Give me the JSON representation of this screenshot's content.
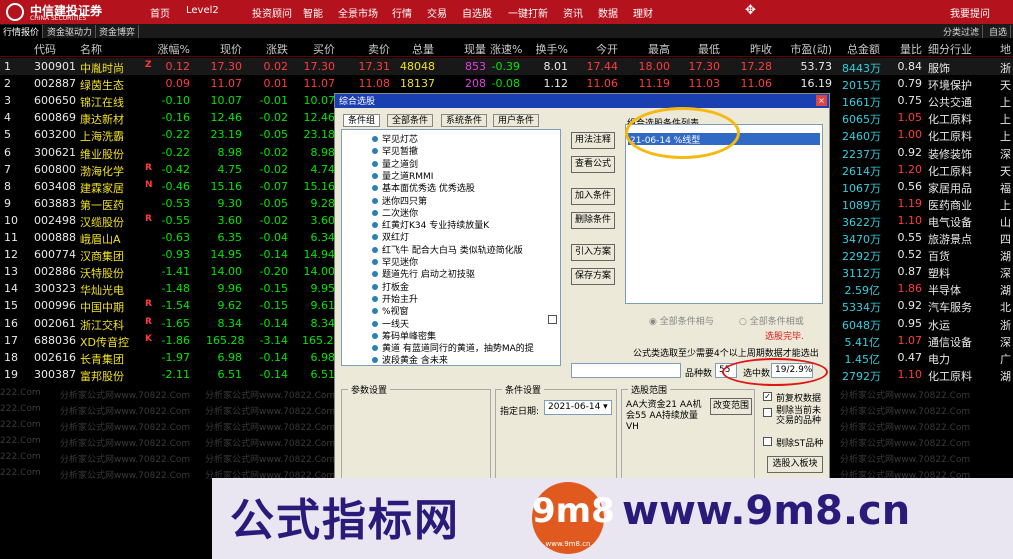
{
  "app": {
    "logo_cn": "中信建投证券",
    "logo_en": "CHINA SECURITIES",
    "nav": [
      "首页",
      "Level2",
      "投资顾问",
      "智能",
      "全景市场",
      "行情",
      "交易",
      "自选股",
      "一键打新",
      "资讯",
      "数据",
      "理财"
    ],
    "hot_badge": "HOT",
    "help": "我要提问"
  },
  "tabs": [
    "行情报价",
    "资金驱动力",
    "资金博弈"
  ],
  "tabs_right": [
    "分类过滤",
    "自选"
  ],
  "table": {
    "columns": [
      "",
      "代码",
      "名称",
      "涨幅%",
      "现价",
      "涨跌",
      "买价",
      "卖价",
      "总量",
      "现量",
      "涨速%",
      "换手%",
      "今开",
      "最高",
      "最低",
      "昨收",
      "市盈(动)",
      "总金额",
      "量比",
      "细分行业",
      "地"
    ],
    "rows": [
      [
        "1",
        "300901",
        "中胤时尚",
        "Z",
        "0.12",
        "17.30",
        "0.02",
        "17.30",
        "17.31",
        "48048",
        "853",
        "-0.39",
        "8.01",
        "17.44",
        "18.00",
        "17.30",
        "17.28",
        "53.73",
        "8443万",
        "0.84",
        "服饰",
        "浙"
      ],
      [
        "2",
        "002887",
        "绿茵生态",
        "",
        "0.09",
        "11.07",
        "0.01",
        "11.07",
        "11.08",
        "18137",
        "208",
        "-0.08",
        "1.12",
        "11.06",
        "11.19",
        "11.03",
        "11.06",
        "16.19",
        "2015万",
        "0.79",
        "环境保护",
        "天"
      ],
      [
        "3",
        "600650",
        "锦江在线",
        "",
        "-0.10",
        "10.07",
        "-0.01",
        "10.07",
        "",
        "",
        "",
        "",
        "",
        "",
        "",
        "",
        "",
        "",
        "1661万",
        "0.75",
        "公共交通",
        "上"
      ],
      [
        "4",
        "600869",
        "康达新材",
        "",
        "-0.16",
        "12.46",
        "-0.02",
        "12.46",
        "",
        "",
        "",
        "",
        "",
        "",
        "",
        "",
        "",
        "",
        "6065万",
        "1.05",
        "化工原料",
        "上"
      ],
      [
        "5",
        "603200",
        "上海洗霸",
        "",
        "-0.22",
        "23.19",
        "-0.05",
        "23.18",
        "",
        "",
        "",
        "",
        "",
        "",
        "",
        "",
        "",
        "",
        "2460万",
        "1.00",
        "化工原料",
        "上"
      ],
      [
        "6",
        "300621",
        "维业股份",
        "",
        "-0.22",
        "8.98",
        "-0.02",
        "8.98",
        "",
        "",
        "",
        "",
        "",
        "",
        "",
        "",
        "",
        "",
        "2237万",
        "0.92",
        "装修装饰",
        "深"
      ],
      [
        "7",
        "600800",
        "渤海化学",
        "R",
        "-0.42",
        "4.75",
        "-0.02",
        "4.74",
        "",
        "",
        "",
        "",
        "",
        "",
        "",
        "",
        "",
        "",
        "2614万",
        "1.20",
        "化工原料",
        "天"
      ],
      [
        "8",
        "603408",
        "建霖家居",
        "N",
        "-0.46",
        "15.16",
        "-0.07",
        "15.16",
        "",
        "",
        "",
        "",
        "",
        "",
        "",
        "",
        "",
        "",
        "1067万",
        "0.56",
        "家居用品",
        "福"
      ],
      [
        "9",
        "603883",
        "第一医药",
        "",
        "-0.53",
        "9.30",
        "-0.05",
        "9.28",
        "",
        "",
        "",
        "",
        "",
        "",
        "",
        "",
        "",
        "",
        "1089万",
        "1.19",
        "医药商业",
        "上"
      ],
      [
        "10",
        "002498",
        "汉缆股份",
        "R",
        "-0.55",
        "3.60",
        "-0.02",
        "3.60",
        "",
        "",
        "",
        "",
        "",
        "",
        "",
        "",
        "",
        "",
        "3622万",
        "1.10",
        "电气设备",
        "山"
      ],
      [
        "11",
        "000888",
        "峨眉山A",
        "",
        "-0.63",
        "6.35",
        "-0.04",
        "6.34",
        "",
        "",
        "",
        "",
        "",
        "",
        "",
        "",
        "",
        "",
        "3470万",
        "0.55",
        "旅游景点",
        "四"
      ],
      [
        "12",
        "600774",
        "汉商集团",
        "",
        "-0.93",
        "14.95",
        "-0.14",
        "14.94",
        "",
        "",
        "",
        "",
        "",
        "",
        "",
        "",
        "",
        "",
        "2292万",
        "0.52",
        "百货",
        "湖"
      ],
      [
        "13",
        "002886",
        "沃特股份",
        "",
        "-1.41",
        "14.00",
        "-0.20",
        "14.00",
        "",
        "",
        "",
        "",
        "",
        "",
        "",
        "",
        "",
        "",
        "3112万",
        "0.87",
        "塑料",
        "深"
      ],
      [
        "14",
        "300323",
        "华灿光电",
        "",
        "-1.48",
        "9.96",
        "-0.15",
        "9.95",
        "",
        "",
        "",
        "",
        "",
        "",
        "",
        "",
        "",
        "",
        "2.59亿",
        "1.86",
        "半导体",
        "湖"
      ],
      [
        "15",
        "000996",
        "中国中期",
        "R",
        "-1.54",
        "9.62",
        "-0.15",
        "9.61",
        "",
        "",
        "",
        "",
        "",
        "",
        "",
        "",
        "",
        "",
        "5334万",
        "0.92",
        "汽车服务",
        "北"
      ],
      [
        "16",
        "002061",
        "浙江交科",
        "R",
        "-1.65",
        "8.34",
        "-0.14",
        "8.34",
        "",
        "",
        "",
        "",
        "",
        "",
        "",
        "",
        "",
        "",
        "6048万",
        "0.95",
        "水运",
        "浙"
      ],
      [
        "17",
        "688036",
        "XD传音控",
        "K",
        "-1.86",
        "165.28",
        "-3.14",
        "165.28",
        "",
        "",
        "",
        "",
        "",
        "",
        "",
        "",
        "",
        "",
        "5.41亿",
        "1.07",
        "通信设备",
        "深"
      ],
      [
        "18",
        "002616",
        "长青集团",
        "",
        "-1.97",
        "6.98",
        "-0.14",
        "6.98",
        "",
        "",
        "",
        "",
        "",
        "",
        "",
        "",
        "",
        "",
        "1.45亿",
        "0.47",
        "电力",
        "广"
      ],
      [
        "19",
        "300387",
        "富邦股份",
        "",
        "-2.11",
        "6.51",
        "-0.14",
        "6.51",
        "",
        "",
        "",
        "",
        "",
        "",
        "",
        "",
        "",
        "",
        "2792万",
        "1.10",
        "化工原料",
        "湖"
      ]
    ]
  },
  "watermark": [
    "分析家公式网www.70822.Com",
    "222.Com"
  ],
  "dialog": {
    "title": "综合选股",
    "close": "×",
    "tabs": [
      "条件组",
      "全部条件",
      "系统条件",
      "用户条件"
    ],
    "tree": [
      "罕见灯芯",
      "罕见暂撤",
      "量之道剑",
      "量之道RMMI",
      "基本面优秀选 优秀选股",
      "迷你四只第",
      "二次迷你",
      "红黄灯K34 专业持续放量K",
      "双红灯",
      "红飞牛 配合大白马 类似轨迹简化版",
      "罕见迷你",
      "题道先行 启动之初技驱",
      "打板金",
      "开始主升",
      "%视窗",
      "一线天",
      "筹码单峰密集",
      "黄道 有蓝道同行的黄道，抽势MA的提",
      "波段黄金 含未来"
    ],
    "buttons": [
      "用法注释",
      "查看公式",
      "加入条件",
      "删除条件",
      "引入方案",
      "保存方案"
    ],
    "list_label": "组合选股条件列表",
    "list_items": [
      "21-06-14 %线型"
    ],
    "radio_and": "全部条件相与",
    "radio_or": "全部条件相或",
    "status": "选股完毕.",
    "formula_note": "公式类选取至少需要4个以上周期数据才能选出",
    "count_label": "品种数",
    "count_value": "55",
    "selected_label": "选中数",
    "selected_value": "19/2.9%",
    "param_group": "参数设置",
    "cond_group": "条件设置",
    "date_label": "指定日期:",
    "date_value": "2021-06-14",
    "range_group": "选股范围",
    "range_text": "AA大资金21 AA机会55 AA持续放量VH",
    "change_range": "改变范围",
    "cb1": "前复权数据",
    "cb2": "剔除当前未交易的品种",
    "cb3": "剔除ST品种",
    "to_block": "选股入板块"
  },
  "banner": {
    "left": "公式指标网",
    "circle": "9m8",
    "circle_small": "www.9m8.cn",
    "right": "www.9m8.cn"
  },
  "colors": {
    "red": "#ff3c3c",
    "green": "#00e600",
    "cyan": "#30d0e0",
    "yellow": "#f0e020",
    "magenta": "#e040e0",
    "brand": "#b4121c"
  }
}
